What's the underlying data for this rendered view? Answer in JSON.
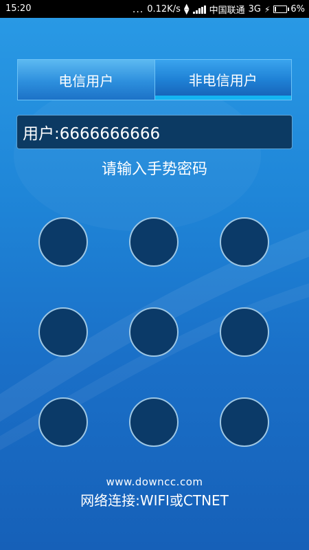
{
  "status_bar": {
    "time": "15:20",
    "dots": "...",
    "speed": "0.12K/s",
    "carrier": "中国联通",
    "network": "3G",
    "battery": "6%"
  },
  "tabs": [
    {
      "label": "电信用户",
      "selected": false
    },
    {
      "label": "非电信用户",
      "selected": true
    }
  ],
  "user": {
    "text": "用户:6666666666"
  },
  "prompt": "请输入手势密码",
  "pattern_grid": {
    "rows": 3,
    "cols": 3
  },
  "footer": {
    "site": "www.downcc.com",
    "network_text": "网络连接:WIFI或CTNET"
  }
}
